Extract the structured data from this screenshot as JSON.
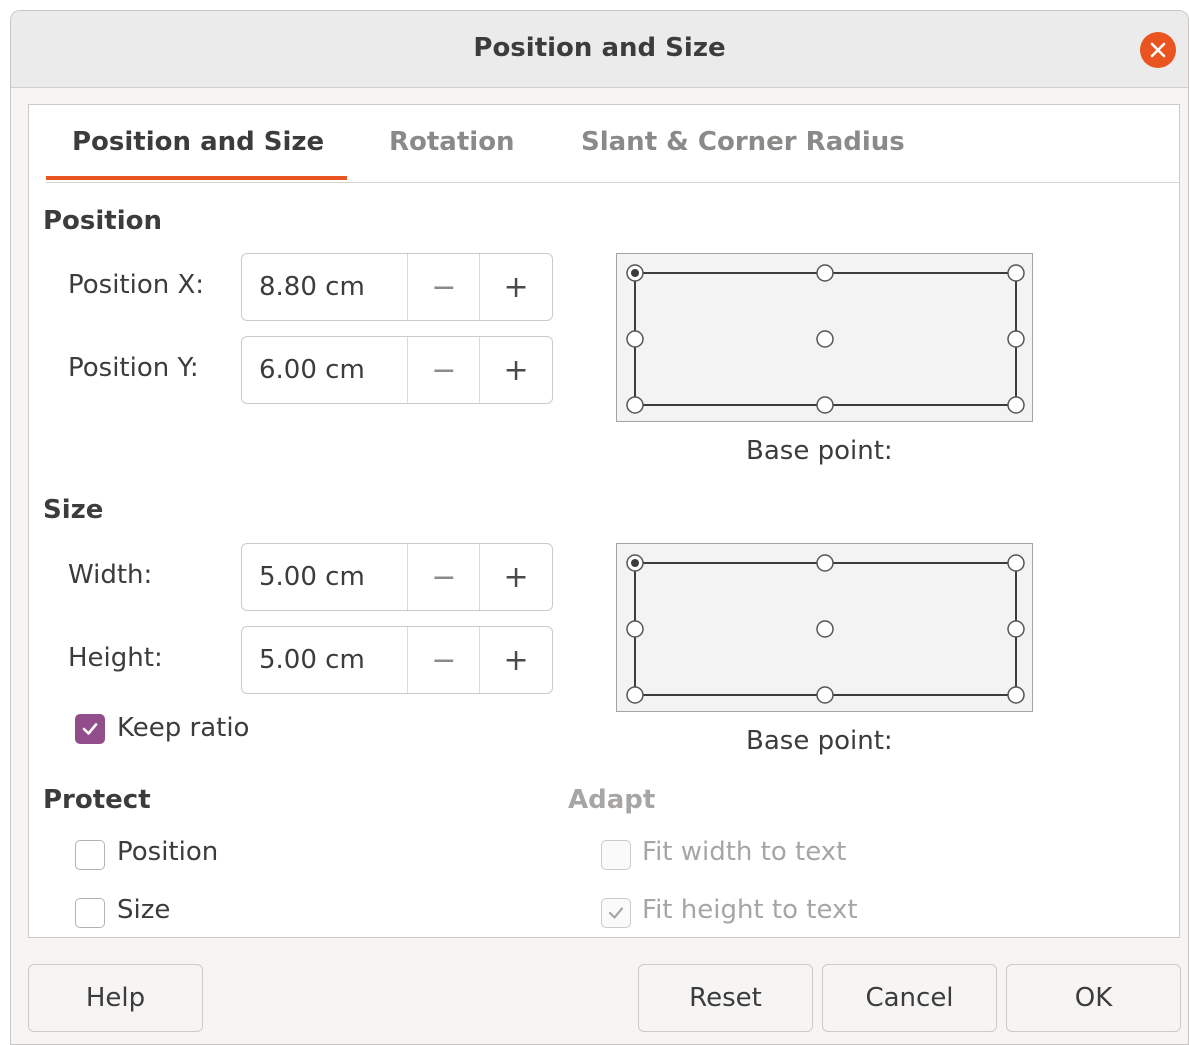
{
  "dialog": {
    "title": "Position and Size",
    "close_icon": "close-icon"
  },
  "tabs": [
    {
      "label": "Position and Size",
      "active": true
    },
    {
      "label": "Rotation",
      "active": false
    },
    {
      "label": "Slant & Corner Radius",
      "active": false
    }
  ],
  "position": {
    "heading": "Position",
    "x_label": "Position X:",
    "x_value": "8.80 cm",
    "y_label": "Position Y:",
    "y_value": "6.00 cm",
    "base_point_label": "Base point:",
    "base_point_selected": "top-left"
  },
  "size": {
    "heading": "Size",
    "width_label": "Width:",
    "width_value": "5.00 cm",
    "height_label": "Height:",
    "height_value": "5.00 cm",
    "keep_ratio_label": "Keep ratio",
    "keep_ratio_checked": true,
    "base_point_label": "Base point:",
    "base_point_selected": "top-left"
  },
  "spin": {
    "minus": "−",
    "plus": "+"
  },
  "protect": {
    "heading": "Protect",
    "position_label": "Position",
    "position_checked": false,
    "size_label": "Size",
    "size_checked": false
  },
  "adapt": {
    "heading": "Adapt",
    "fit_width_label": "Fit width to text",
    "fit_width_checked": false,
    "fit_height_label": "Fit height to text",
    "fit_height_checked": true,
    "disabled": true
  },
  "buttons": {
    "help": "Help",
    "reset": "Reset",
    "cancel": "Cancel",
    "ok": "OK"
  },
  "colors": {
    "accent": "#e95420",
    "checkbox_checked": "#924d8b"
  }
}
